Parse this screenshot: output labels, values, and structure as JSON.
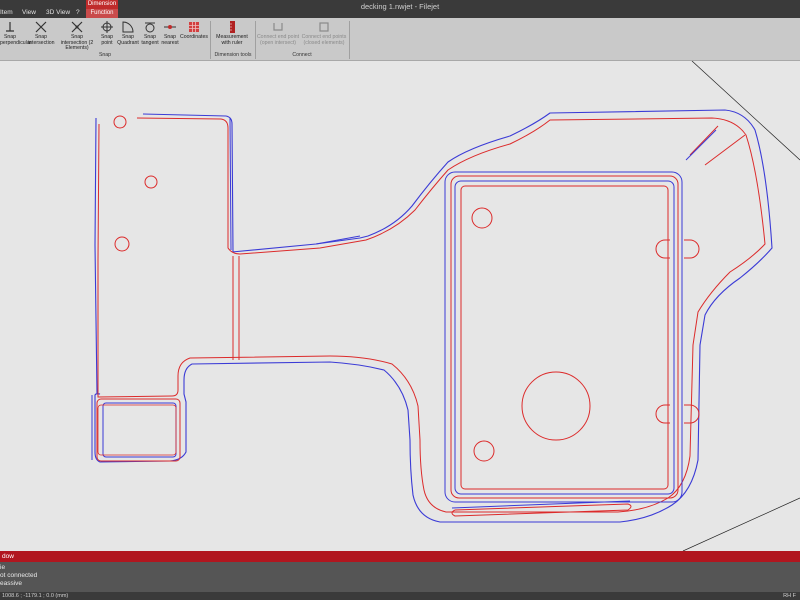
{
  "window": {
    "title": "decking 1.nwjet - Filejet"
  },
  "menu": {
    "items": [
      "Item",
      "View",
      "3D View",
      "?"
    ],
    "context_tab_top": "Dimension",
    "context_tab_bottom": "Function"
  },
  "ribbon": {
    "snap_buttons": [
      {
        "label": "Snap perpendicular",
        "icon": "snap-perpendicular-icon"
      },
      {
        "label": "Snap intersection",
        "icon": "snap-intersection-icon"
      },
      {
        "label": "Snap intersection (2 Elements)",
        "icon": "snap-intersection-two-icon"
      },
      {
        "label": "Snap point",
        "icon": "snap-point-icon"
      },
      {
        "label": "Snap Quadrant",
        "icon": "snap-quadrant-icon"
      },
      {
        "label": "Snap tangent",
        "icon": "snap-tangent-icon"
      },
      {
        "label": "Snap nearest",
        "icon": "snap-nearest-icon"
      },
      {
        "label": "Coordinates",
        "icon": "coordinates-icon"
      }
    ],
    "snap_group_label": "Snap",
    "measure_button": {
      "label": "Measurement with ruler",
      "icon": "ruler-icon"
    },
    "dimension_group_label": "Dimension tools",
    "connect_buttons": [
      {
        "label": "Connect end point (open intersect)",
        "icon": "connect-endpoint-icon"
      },
      {
        "label": "Connect end points (closed elements)",
        "icon": "connect-endpoints-icon"
      }
    ],
    "connect_group_label": "Connect"
  },
  "output": {
    "header": "dow",
    "lines": [
      "ie",
      "ot connected",
      "eassive"
    ]
  },
  "status": {
    "coords": "1008.6 ; -1179.1 ; 0.0 (mm)",
    "right": "RH F"
  },
  "colors": {
    "contour_red": "#dc2b2b",
    "contour_blue": "#3b3bd6",
    "accent": "#b1161f"
  }
}
